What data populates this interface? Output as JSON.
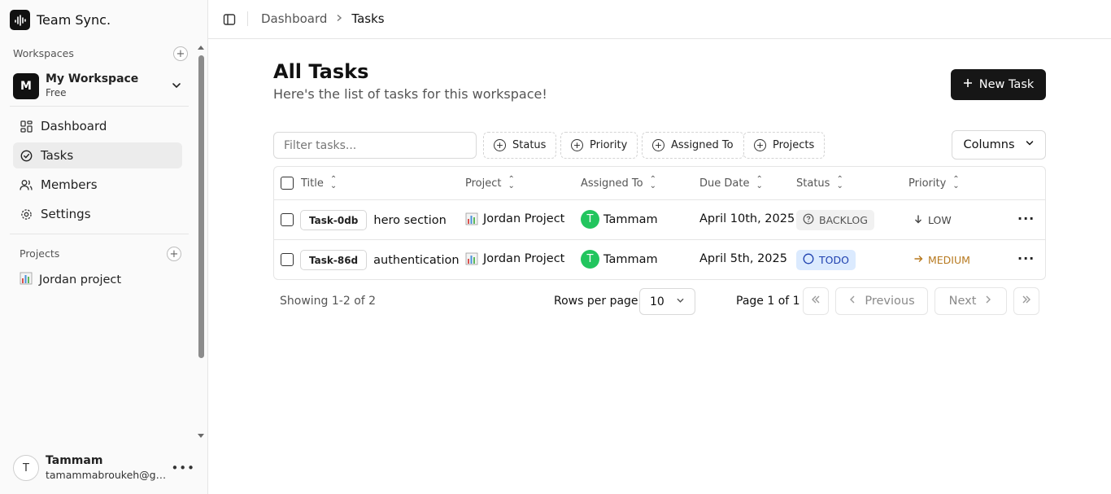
{
  "app": {
    "name": "Team Sync."
  },
  "sidebar": {
    "workspaces_label": "Workspaces",
    "workspace": {
      "initial": "M",
      "name": "My Workspace",
      "plan": "Free"
    },
    "nav": [
      {
        "label": "Dashboard",
        "icon": "dashboard-icon"
      },
      {
        "label": "Tasks",
        "icon": "tasks-icon",
        "active": true
      },
      {
        "label": "Members",
        "icon": "members-icon"
      },
      {
        "label": "Settings",
        "icon": "gear-icon"
      }
    ],
    "projects_label": "Projects",
    "projects": [
      {
        "emoji": "chart-icon",
        "label": "Jordan project"
      }
    ],
    "user": {
      "initial": "T",
      "name": "Tammam",
      "email": "tamammabroukeh@gmail.com"
    }
  },
  "header": {
    "breadcrumb": [
      "Dashboard",
      "Tasks"
    ]
  },
  "main": {
    "title": "All Tasks",
    "subtitle": "Here's the list of tasks for this workspace!",
    "new_task_label": "New Task",
    "filter_placeholder": "Filter tasks...",
    "facets": [
      "Status",
      "Priority",
      "Assigned To",
      "Projects"
    ],
    "columns_label": "Columns",
    "table": {
      "headers": [
        "Title",
        "Project",
        "Assigned To",
        "Due Date",
        "Status",
        "Priority"
      ],
      "rows": [
        {
          "code": "Task-0db",
          "title": "hero section",
          "project": "Jordan Project",
          "assignee_initial": "T",
          "assignee": "Tammam",
          "due": "April 10th, 2025",
          "status": "BACKLOG",
          "priority": "LOW"
        },
        {
          "code": "Task-86d",
          "title": "authentication",
          "project": "Jordan Project",
          "assignee_initial": "T",
          "assignee": "Tammam",
          "due": "April 5th, 2025",
          "status": "TODO",
          "priority": "MEDIUM"
        }
      ]
    },
    "pagination": {
      "showing": "Showing 1-2 of 2",
      "rows_per_page_label": "Rows per page",
      "rows_per_page": "10",
      "page_of": "Page 1 of 1",
      "previous": "Previous",
      "next": "Next"
    }
  },
  "colors": {
    "accent": "#161616",
    "assignee": "#22c55e",
    "todo_bg": "#dbeafe",
    "medium": "#b7791f"
  }
}
